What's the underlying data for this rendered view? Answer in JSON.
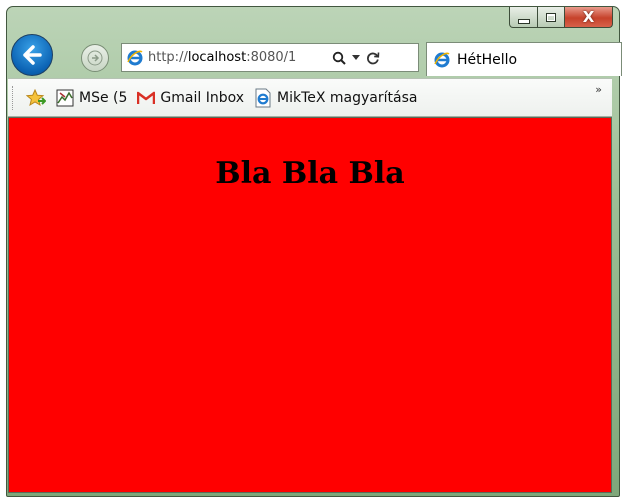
{
  "window": {
    "controls": {
      "minimize_icon": "minimize-icon",
      "maximize_icon": "maximize-icon",
      "close_glyph": "X"
    }
  },
  "nav": {
    "back_icon": "back-arrow-icon",
    "forward_icon": "forward-arrow-icon",
    "address": {
      "url_prefix": "http://",
      "url_host": "localhost",
      "url_rest": ":8080/1"
    },
    "tab": {
      "label": "HétHello"
    }
  },
  "favorites": {
    "items": [
      {
        "label": "MSe (5",
        "icon": "favorite-site-icon"
      },
      {
        "label": "Gmail Inbox",
        "icon": "gmail-icon"
      },
      {
        "label": "MikTeX magyarítása",
        "icon": "ie-page-icon"
      }
    ],
    "more": "»"
  },
  "page": {
    "heading": "Bla Bla Bla",
    "background": "#ff0000"
  },
  "colors": {
    "frame": "#9cbf95",
    "accent_blue": "#0b62b3",
    "close_red": "#c6422b"
  }
}
